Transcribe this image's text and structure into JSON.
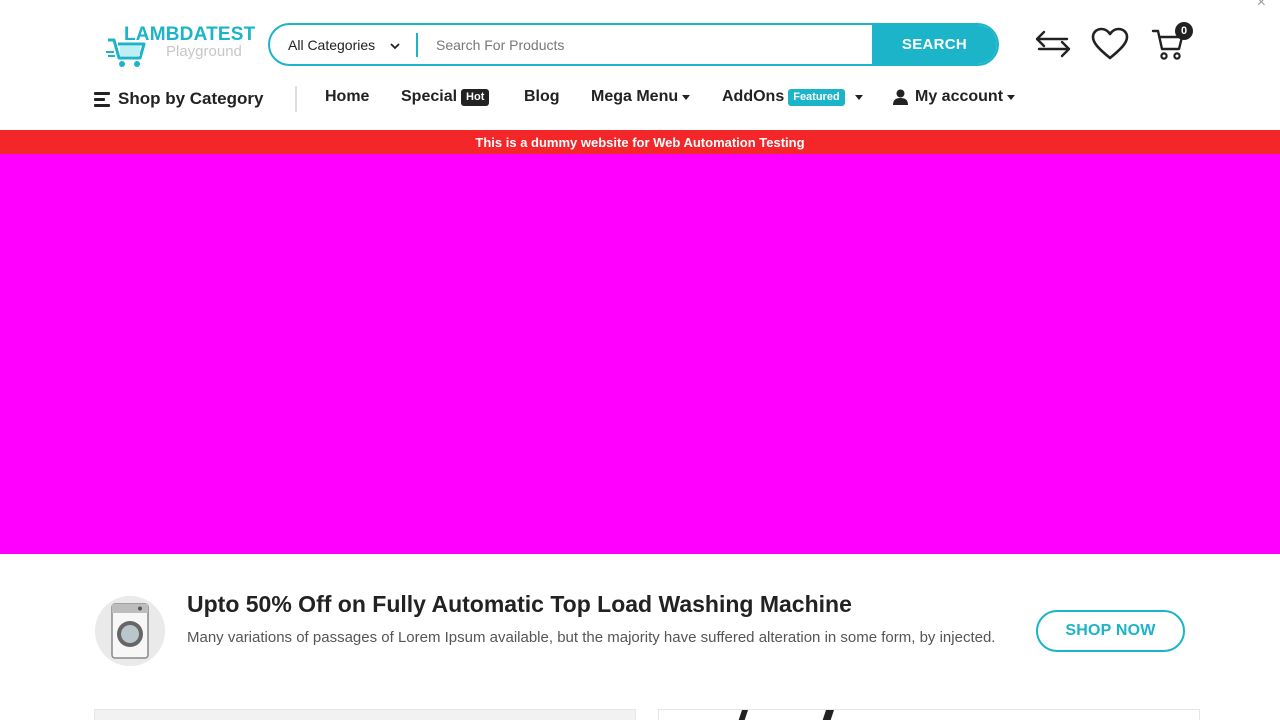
{
  "header": {
    "close_glyph": "×",
    "logo": {
      "brand": "LAMBDATEST",
      "sub": "Playground",
      "icon": "cart-logo-icon"
    },
    "search": {
      "category": "All Categories",
      "placeholder": "Search For Products",
      "button": "SEARCH"
    },
    "icons": {
      "compare": "compare-arrows-icon",
      "wishlist": "heart-icon",
      "cart": "cart-icon"
    },
    "cart_count": "0"
  },
  "nav": {
    "shop_by_category": "Shop by Category",
    "items": [
      {
        "label": "Home"
      },
      {
        "label": "Special",
        "badge": "Hot"
      },
      {
        "label": "Blog"
      },
      {
        "label": "Mega Menu"
      },
      {
        "label": "AddOns",
        "badge": "Featured"
      },
      {
        "label": "My account"
      }
    ]
  },
  "notice_banner": "This is a dummy website for Web Automation Testing",
  "promo": {
    "title": "Upto 50% Off on Fully Automatic Top Load Washing Machine",
    "description": "Many variations of passages of Lorem Ipsum available, but the majority have suffered alteration in some form, by injected.",
    "button": "SHOP NOW",
    "image": "washing-machine-image"
  },
  "colors": {
    "accent": "#1cb4c8",
    "banner": "#f3272a",
    "hero": "#ff00ff",
    "text": "#222222"
  }
}
